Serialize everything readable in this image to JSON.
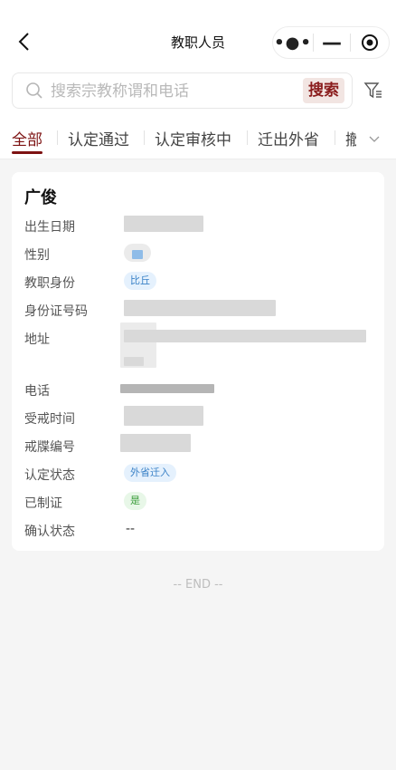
{
  "nav": {
    "title": "教职人员"
  },
  "search": {
    "placeholder": "搜索宗教称谓和电话",
    "button_label": "搜索"
  },
  "tabs": [
    {
      "label": "全部",
      "active": true
    },
    {
      "label": "认定通过"
    },
    {
      "label": "认定审核中"
    },
    {
      "label": "迁出外省"
    },
    {
      "label": "撤"
    }
  ],
  "card": {
    "name": "广俊",
    "fields": [
      {
        "label": "出生日期"
      },
      {
        "label": "性别"
      },
      {
        "label": "教职身份",
        "tag": "比丘"
      },
      {
        "label": "身份证号码"
      },
      {
        "label": "地址"
      },
      {
        "label": "电话"
      },
      {
        "label": "受戒时间"
      },
      {
        "label": "戒牒编号"
      },
      {
        "label": "认定状态",
        "tag": "外省迁入"
      },
      {
        "label": "已制证",
        "tag": "是"
      },
      {
        "label": "确认状态",
        "value": "--"
      }
    ]
  },
  "footer": {
    "end_text": "-- END --"
  },
  "colors": {
    "accent": "#7d1212",
    "tag_blue": "#3b82c7",
    "tag_green": "#3a9c3a"
  }
}
